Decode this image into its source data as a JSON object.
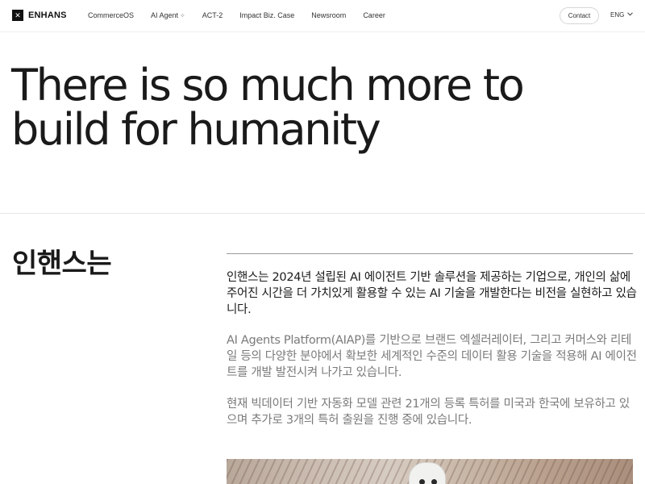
{
  "header": {
    "logo_text": "ENHANS",
    "logo_mark": "✕",
    "nav": [
      {
        "label": "CommerceOS"
      },
      {
        "label": "AI Agent",
        "badge": "✧"
      },
      {
        "label": "ACT-2"
      },
      {
        "label": "Impact Biz. Case"
      },
      {
        "label": "Newsroom"
      },
      {
        "label": "Career"
      }
    ],
    "contact_label": "Contact",
    "language": "ENG"
  },
  "hero": {
    "line1": "There is so much more to",
    "line2": "build for humanity"
  },
  "about": {
    "heading": "인핸스는",
    "paragraph1": "인핸스는 2024년 설립된 AI 에이전트 기반 솔루션을 제공하는 기업으로, 개인의 삶에 주어진 시간을 더 가치있게 활용할 수 있는 AI 기술을 개발한다는 비전을 실현하고 있습니다.",
    "paragraph2": "AI Agents Platform(AIAP)를 기반으로 브랜드 엑셀러레이터, 그리고 커머스와 리테일 등의 다양한 분야에서 확보한 세계적인 수준의 데이터 활용 기술을 적용해 AI 에이전트를 개발 발전시켜 나가고 있습니다.",
    "paragraph3": "현재 빅데이터 기반 자동화 모델 관련 21개의 등록 특허를 미국과 한국에 보유하고 있으며 추가로 3개의 특허 출원을 진행 중에 있습니다."
  },
  "icons": {
    "logo": "x-logo-icon",
    "sparkle": "sparkle-icon",
    "language_chevron": "chevron-down-icon"
  },
  "colors": {
    "text_primary": "#1a1a1a",
    "text_secondary": "#7a7a7a",
    "divider": "#e6e6e6"
  }
}
